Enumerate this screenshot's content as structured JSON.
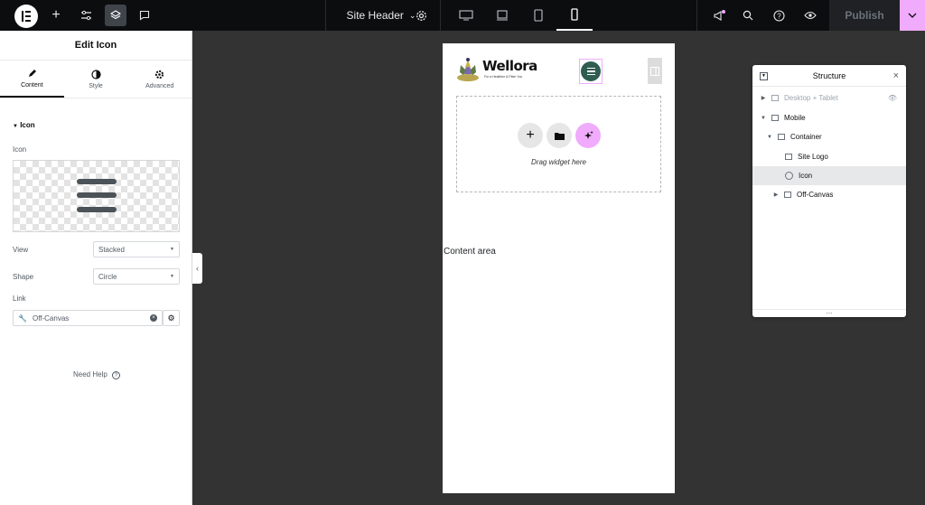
{
  "topbar": {
    "doc_name": "Site Header",
    "publish_label": "Publish"
  },
  "panel": {
    "title": "Edit Icon",
    "tabs": [
      {
        "label": "Content"
      },
      {
        "label": "Style"
      },
      {
        "label": "Advanced"
      }
    ],
    "section": "Icon",
    "icon_label": "Icon",
    "view_label": "View",
    "view_value": "Stacked",
    "shape_label": "Shape",
    "shape_value": "Circle",
    "link_label": "Link",
    "link_value": "Off-Canvas",
    "help": "Need Help"
  },
  "canvas": {
    "brand": "Wellora",
    "tagline": "For a Healthier & Fitter You",
    "drop_text": "Drag widget here",
    "content_area": "Content area"
  },
  "structure": {
    "title": "Structure",
    "items": [
      {
        "label": "Desktop + Tablet"
      },
      {
        "label": "Mobile"
      },
      {
        "label": "Container"
      },
      {
        "label": "Site Logo"
      },
      {
        "label": "Icon"
      },
      {
        "label": "Off-Canvas"
      }
    ],
    "footer": "..."
  },
  "colors": {
    "accent": "#f0abfc",
    "dark": "#0c0d0e",
    "icon_circle": "#2f5d50"
  }
}
